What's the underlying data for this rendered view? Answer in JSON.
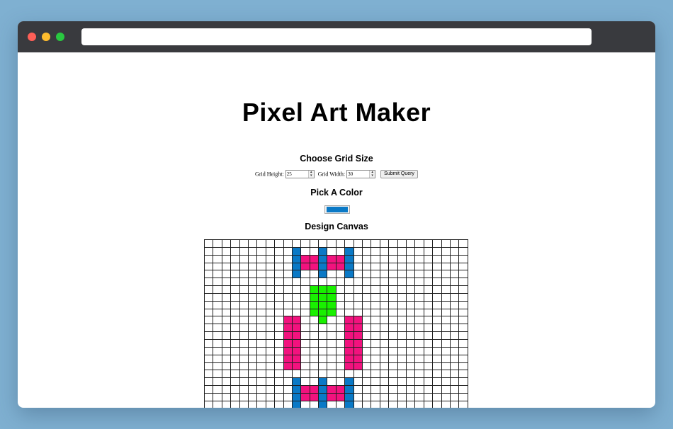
{
  "page": {
    "title": "Pixel Art Maker",
    "size_heading": "Choose Grid Size",
    "height_label": "Grid Height:",
    "height_value": "25",
    "width_label": "Grid Width:",
    "width_value": "30",
    "submit_label": "Submit Query",
    "color_heading": "Pick A Color",
    "selected_color": "#0a79c6",
    "canvas_heading": "Design Canvas"
  },
  "colors": {
    "blue": "#0a79c6",
    "pink": "#f2127e",
    "green": "#19f000"
  },
  "canvas": {
    "rows": 25,
    "cols": 30,
    "painted": [
      {
        "color": "blue",
        "cells": [
          [
            1,
            10
          ],
          [
            2,
            10
          ],
          [
            3,
            10
          ],
          [
            4,
            10
          ],
          [
            1,
            13
          ],
          [
            2,
            13
          ],
          [
            3,
            13
          ],
          [
            4,
            13
          ],
          [
            1,
            16
          ],
          [
            2,
            16
          ],
          [
            3,
            16
          ],
          [
            4,
            16
          ],
          [
            18,
            10
          ],
          [
            19,
            10
          ],
          [
            20,
            10
          ],
          [
            21,
            10
          ],
          [
            18,
            13
          ],
          [
            19,
            13
          ],
          [
            20,
            13
          ],
          [
            21,
            13
          ],
          [
            18,
            16
          ],
          [
            19,
            16
          ],
          [
            20,
            16
          ],
          [
            21,
            16
          ]
        ]
      },
      {
        "color": "pink",
        "cells": [
          [
            2,
            11
          ],
          [
            2,
            12
          ],
          [
            2,
            14
          ],
          [
            2,
            15
          ],
          [
            3,
            11
          ],
          [
            3,
            12
          ],
          [
            3,
            14
          ],
          [
            3,
            15
          ],
          [
            19,
            11
          ],
          [
            19,
            12
          ],
          [
            19,
            14
          ],
          [
            19,
            15
          ],
          [
            20,
            11
          ],
          [
            20,
            12
          ],
          [
            20,
            14
          ],
          [
            20,
            15
          ],
          [
            10,
            9
          ],
          [
            10,
            10
          ],
          [
            11,
            9
          ],
          [
            11,
            10
          ],
          [
            12,
            9
          ],
          [
            12,
            10
          ],
          [
            13,
            9
          ],
          [
            13,
            10
          ],
          [
            14,
            9
          ],
          [
            14,
            10
          ],
          [
            15,
            9
          ],
          [
            15,
            10
          ],
          [
            16,
            9
          ],
          [
            16,
            10
          ],
          [
            10,
            16
          ],
          [
            10,
            17
          ],
          [
            11,
            16
          ],
          [
            11,
            17
          ],
          [
            12,
            16
          ],
          [
            12,
            17
          ],
          [
            13,
            16
          ],
          [
            13,
            17
          ],
          [
            14,
            16
          ],
          [
            14,
            17
          ],
          [
            15,
            16
          ],
          [
            15,
            17
          ],
          [
            16,
            16
          ],
          [
            16,
            17
          ]
        ]
      },
      {
        "color": "green",
        "cells": [
          [
            6,
            12
          ],
          [
            6,
            13
          ],
          [
            6,
            14
          ],
          [
            7,
            12
          ],
          [
            7,
            13
          ],
          [
            7,
            14
          ],
          [
            8,
            12
          ],
          [
            8,
            13
          ],
          [
            8,
            14
          ],
          [
            9,
            12
          ],
          [
            9,
            13
          ],
          [
            9,
            14
          ],
          [
            10,
            13
          ]
        ]
      }
    ]
  }
}
